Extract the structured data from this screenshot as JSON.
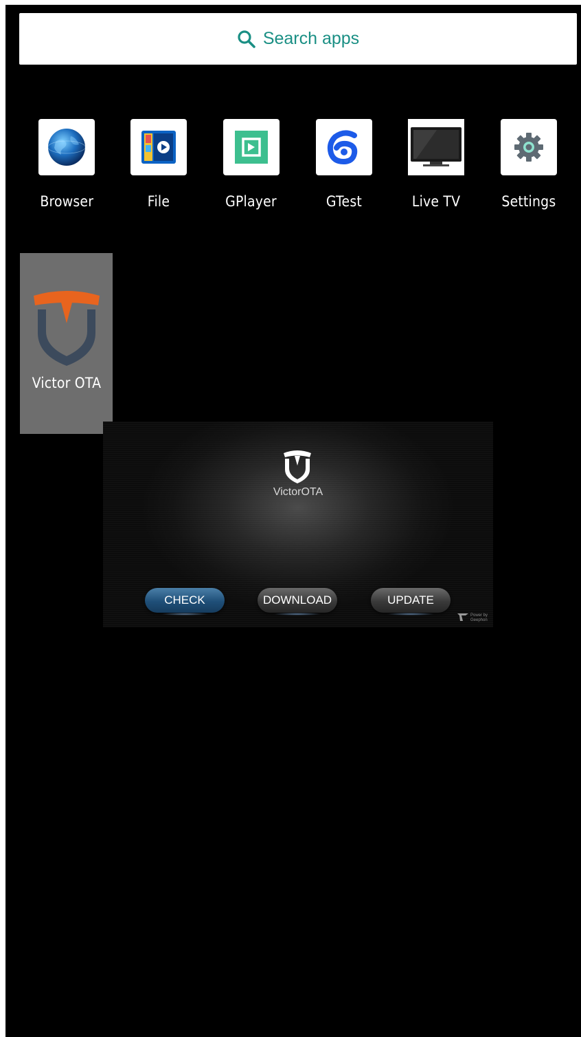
{
  "search": {
    "label": "Search apps"
  },
  "apps": [
    {
      "label": "Browser",
      "icon": "globe-icon"
    },
    {
      "label": "File",
      "icon": "video-file-icon"
    },
    {
      "label": "GPlayer",
      "icon": "gplayer-icon"
    },
    {
      "label": "GTest",
      "icon": "gtest-icon"
    },
    {
      "label": "Live TV",
      "icon": "tv-icon"
    },
    {
      "label": "Settings",
      "icon": "gear-icon"
    }
  ],
  "selected_app": {
    "label": "Victor OTA",
    "icon": "victor-ota-shield-icon"
  },
  "preview": {
    "title": "VictorOTA",
    "buttons": {
      "check": "CHECK",
      "download": "DOWNLOAD",
      "update": "UPDATE"
    },
    "powered_by_line1": "Power by",
    "powered_by_line2": "Geephon"
  },
  "colors": {
    "background": "#000000",
    "search_text": "#1a8f84",
    "selected_tile": "#6e6e6e",
    "ota_orange": "#e8641e",
    "ota_navy": "#3c4a5c",
    "gplayer_green": "#3dbf8f",
    "gtest_blue": "#1d5be8"
  }
}
